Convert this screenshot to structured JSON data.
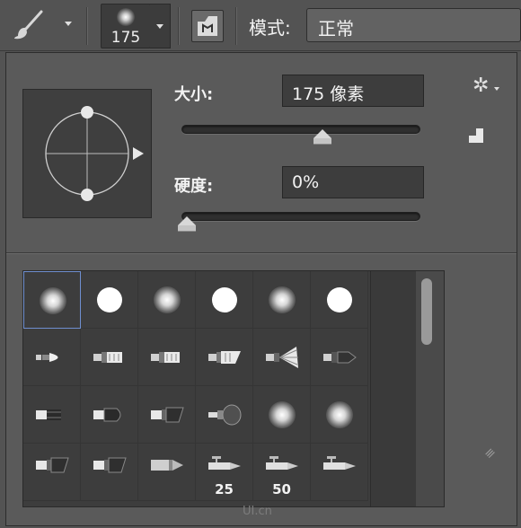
{
  "optionsbar": {
    "tool_icon": "brush-icon",
    "brush_size_readout": "175",
    "toggle_icon": "brush-panel-toggle-icon",
    "mode_label": "模式:",
    "mode_value": "正常"
  },
  "picker": {
    "size_label": "大小:",
    "size_value": "175 像素",
    "size_slider_fraction": 0.6,
    "hardness_label": "硬度:",
    "hardness_value": "0%",
    "hardness_slider_fraction": 0.0,
    "settings_icon": "gear-icon",
    "new_preset_icon": "new-preset-icon"
  },
  "presets": {
    "rows": [
      [
        "soft-round",
        "hard-round",
        "soft-round",
        "hard-round",
        "soft-round",
        "hard-round"
      ],
      [
        "bristle-brush",
        "flat-bristle",
        "flat-bristle",
        "angled-bristle",
        "fan-brush",
        "point-brush"
      ],
      [
        "flat-brush",
        "round-blunt",
        "angled-flat",
        "sponge-brush",
        "soft-round",
        "soft-round"
      ],
      [
        "angled-flat",
        "angled-flat",
        "pencil-tip",
        "airbrush",
        "airbrush",
        "airbrush"
      ]
    ],
    "size_labels": [
      "25",
      "50"
    ]
  },
  "watermark": "UI.cn"
}
